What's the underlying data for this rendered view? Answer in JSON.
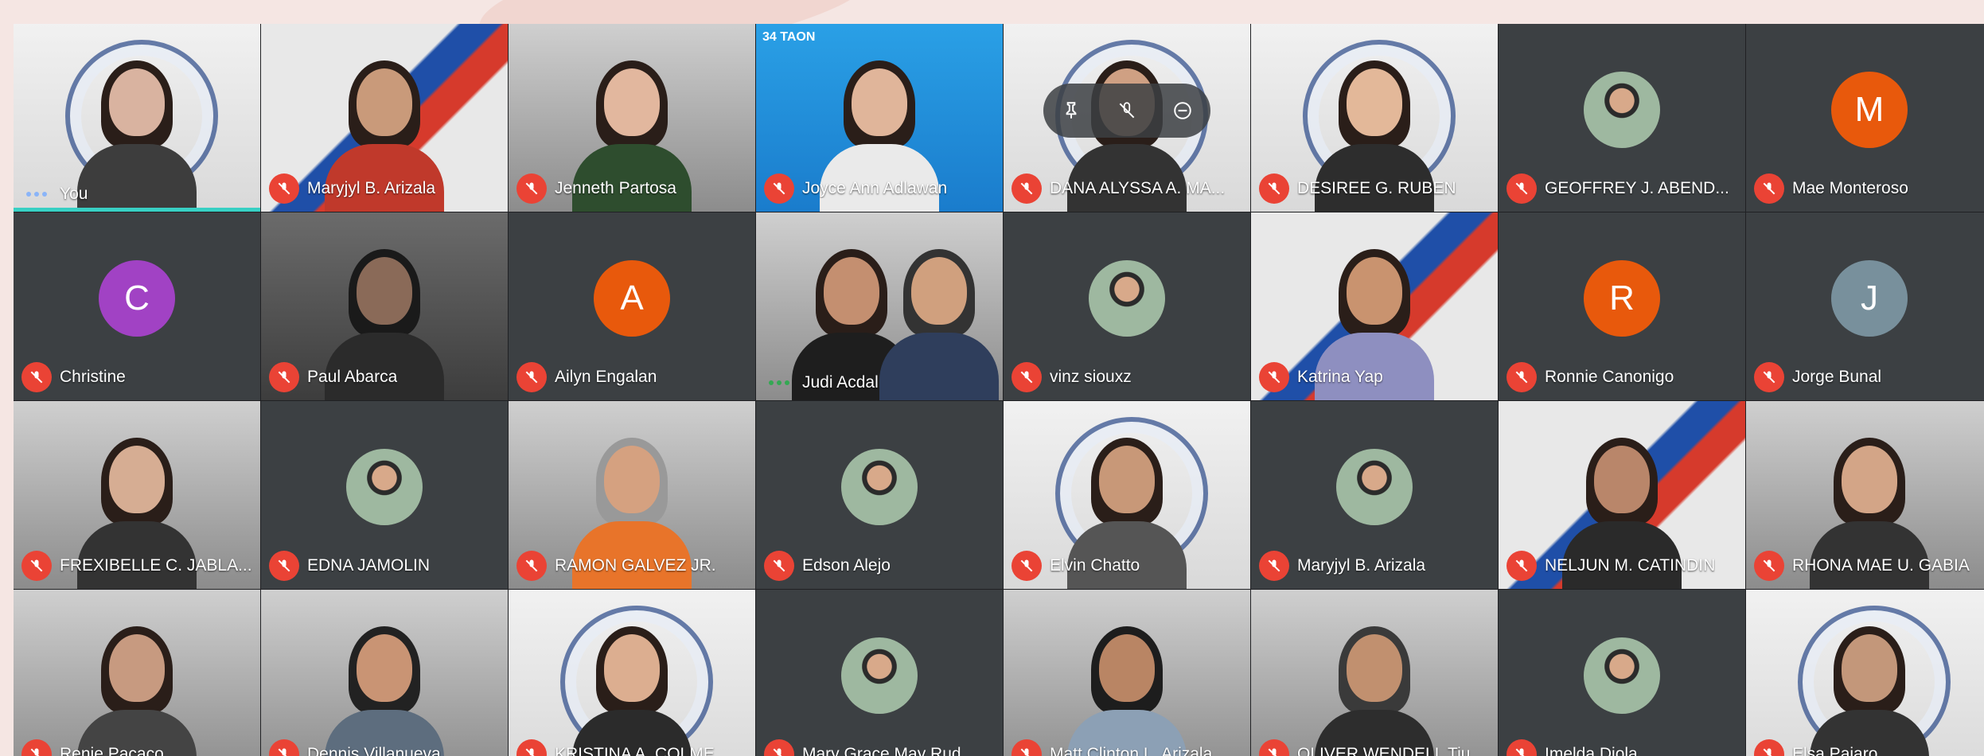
{
  "theme": {
    "tile_bg": "#3c4043",
    "mic_off_color": "#ea4335",
    "self_indicator": "#38d0c4",
    "page_bg": "#f5e6e3"
  },
  "participants": [
    {
      "name": "You"
    },
    {
      "name": "Maryjyl B. Arizala"
    },
    {
      "name": "Jenneth Partosa"
    },
    {
      "name": "Joyce Ann Adlawan",
      "banner": "34 TAON"
    },
    {
      "name": "DANA ALYSSA A. MA..."
    },
    {
      "name": "DESIREE G. RUBEN"
    },
    {
      "name": "GEOFFREY J. ABEND..."
    },
    {
      "name": "Mae Monteroso",
      "initial": "M",
      "avatar_color": "#e8590c"
    },
    {
      "name": "Christine",
      "initial": "C",
      "avatar_color": "#a142c4"
    },
    {
      "name": "Paul Abarca"
    },
    {
      "name": "Ailyn Engalan",
      "initial": "A",
      "avatar_color": "#e8590c"
    },
    {
      "name": "Judi Acdal"
    },
    {
      "name": "vinz siouxz"
    },
    {
      "name": "Katrina Yap"
    },
    {
      "name": "Ronnie Canonigo",
      "initial": "R",
      "avatar_color": "#e8590c"
    },
    {
      "name": "Jorge Bunal",
      "initial": "J",
      "avatar_color": "#78909c"
    },
    {
      "name": "FREXIBELLE C. JABLA..."
    },
    {
      "name": "EDNA JAMOLIN"
    },
    {
      "name": "RAMON GALVEZ JR."
    },
    {
      "name": "Edson Alejo"
    },
    {
      "name": "Elvin Chatto"
    },
    {
      "name": "Maryjyl B. Arizala"
    },
    {
      "name": "NELJUN M. CATINDIN"
    },
    {
      "name": "RHONA MAE U. GABIA"
    },
    {
      "name": "Renie Pacaco"
    },
    {
      "name": "Dennis Villanueva"
    },
    {
      "name": "KRISTINA A. COLME..."
    },
    {
      "name": "Mary Grace May Rud..."
    },
    {
      "name": "Matt Clinton L. Arizala"
    },
    {
      "name": "OLIVER WENDELL Tiu"
    },
    {
      "name": "Imelda Diola"
    },
    {
      "name": "Elsa Pajaro"
    }
  ]
}
